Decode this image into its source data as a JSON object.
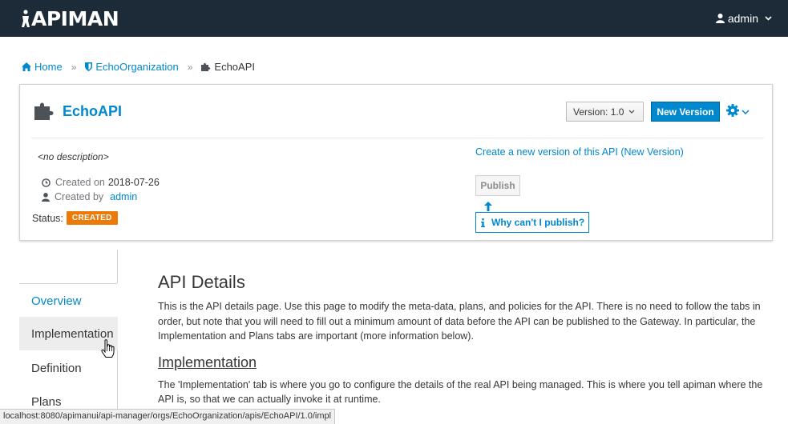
{
  "header": {
    "logo_text": "APIMAN",
    "user_label": "admin"
  },
  "breadcrumb": {
    "home": "Home",
    "org": "EchoOrganization",
    "api": "EchoAPI"
  },
  "api": {
    "title": "EchoAPI",
    "version_label": "Version: 1.0",
    "new_version_button": "New Version",
    "description": "<no description>",
    "created_on_label": "Created on",
    "created_on_value": "2018-07-26",
    "created_by_label": "Created by",
    "created_by_value": "admin",
    "status_label": "Status:",
    "status_value": "CREATED",
    "status_color": "#ec7a08",
    "create_version_link": "Create a new version of this API (New Version)",
    "publish_button": "Publish",
    "why_cant_publish": "Why can't I publish?"
  },
  "sidenav": {
    "items": [
      {
        "label": "Overview"
      },
      {
        "label": "Implementation"
      },
      {
        "label": "Definition"
      },
      {
        "label": "Plans"
      }
    ]
  },
  "content": {
    "title": "API Details",
    "intro": "This is the API details page. Use this page to modify the meta-data, plans, and policies for the API. There is no need to follow the tabs in order, but note that you will need to fill out a minimum amount of data before the API can be published to the Gateway. In particular, the Implementation and Plans tabs are important (more information below).",
    "section_title": "Implementation",
    "section_text": "The 'Implementation' tab is where you go to configure the details of the real API being managed. This is where you tell apiman where the API is, so that we can actually invoke it at runtime."
  },
  "statusbar": {
    "url": "localhost:8080/apimanui/api-manager/orgs/EchoOrganization/apis/EchoAPI/1.0/impl"
  },
  "colors": {
    "topbar": "#1d2b38",
    "accent": "#0088ce",
    "text": "#363636"
  }
}
